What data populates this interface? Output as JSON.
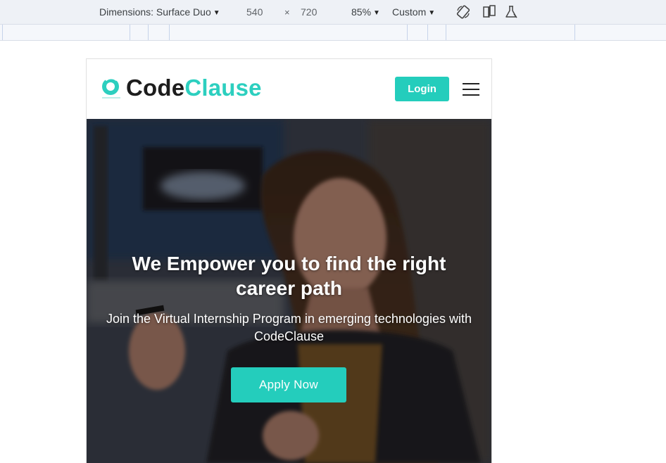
{
  "devtools": {
    "dimensions_label": "Dimensions: Surface Duo",
    "width": "540",
    "times": "×",
    "height": "720",
    "zoom": "85%",
    "throttle": "Custom",
    "icons": [
      "rotate-icon",
      "dual-screen-icon",
      "sensors-flask-icon"
    ]
  },
  "site": {
    "logo": {
      "code": "Code",
      "clause": "Clause"
    },
    "login_label": "Login",
    "menu_icon": "hamburger-menu-icon"
  },
  "hero": {
    "title": "We Empower you to find the right career path",
    "subtitle": "Join the Virtual Internship Program in emerging technologies with CodeClause",
    "cta_label": "Apply Now"
  },
  "colors": {
    "accent": "#24cdbc",
    "logo_clause": "#2ccfbf",
    "logo_code": "#1d1d1d",
    "toolbar_bg": "#eef1f6"
  }
}
